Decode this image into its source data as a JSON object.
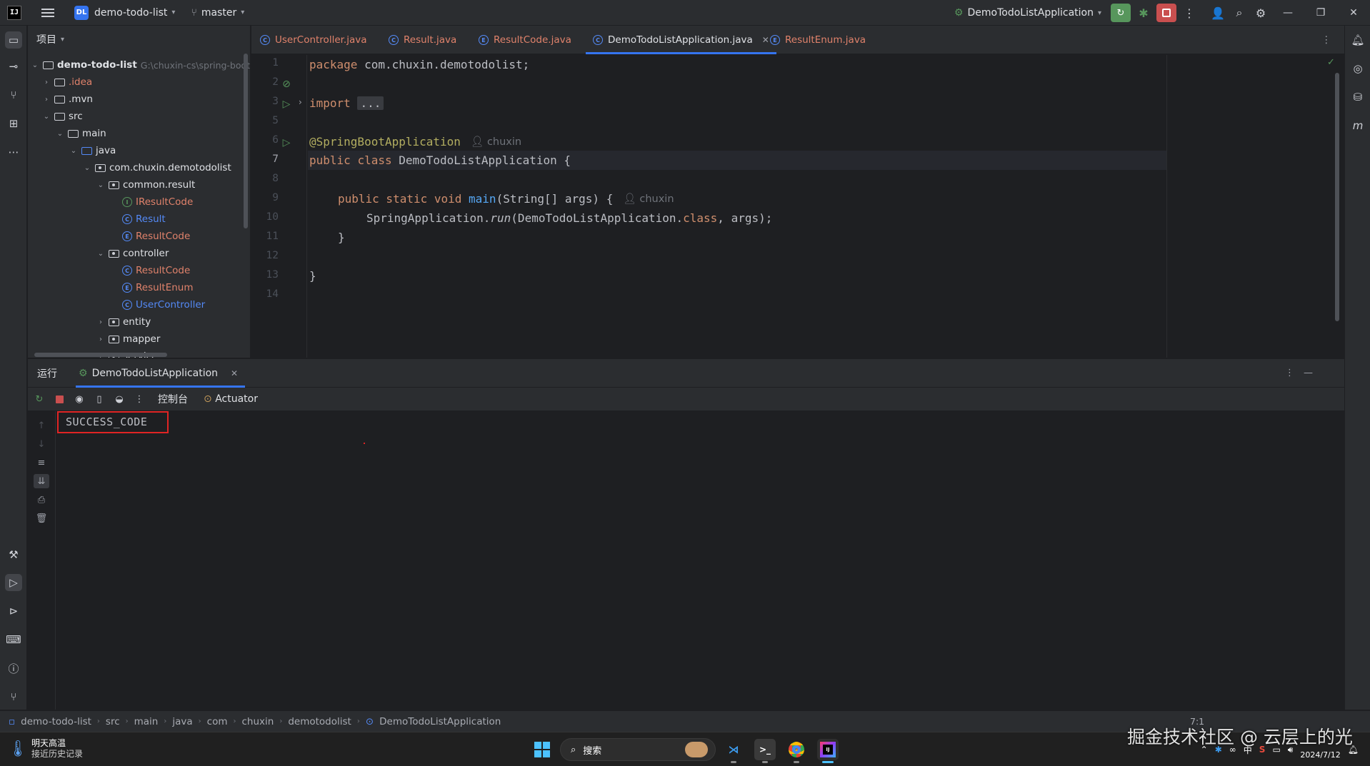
{
  "titlebar": {
    "project_badge": "DL",
    "project_name": "demo-todo-list",
    "branch": "master",
    "run_config": "DemoTodoListApplication"
  },
  "project_panel": {
    "title": "项目",
    "tree": [
      {
        "label": "demo-todo-list",
        "hint": "G:\\chuxin-cs\\spring-boot-",
        "type": "module"
      },
      {
        "label": ".idea",
        "type": "folder"
      },
      {
        "label": ".mvn",
        "type": "folder"
      },
      {
        "label": "src",
        "type": "folder"
      },
      {
        "label": "main",
        "type": "folder"
      },
      {
        "label": "java",
        "type": "folder"
      },
      {
        "label": "com.chuxin.demotodolist",
        "type": "package"
      },
      {
        "label": "common.result",
        "type": "package"
      },
      {
        "label": "IResultCode",
        "type": "interface"
      },
      {
        "label": "Result",
        "type": "class"
      },
      {
        "label": "ResultCode",
        "type": "enum"
      },
      {
        "label": "controller",
        "type": "package"
      },
      {
        "label": "ResultCode",
        "type": "class"
      },
      {
        "label": "ResultEnum",
        "type": "enum"
      },
      {
        "label": "UserController",
        "type": "class"
      },
      {
        "label": "entity",
        "type": "package"
      },
      {
        "label": "mapper",
        "type": "package"
      },
      {
        "label": "service",
        "type": "package"
      }
    ]
  },
  "tabs": [
    {
      "label": "UserController.java"
    },
    {
      "label": "Result.java"
    },
    {
      "label": "ResultCode.java"
    },
    {
      "label": "DemoTodoListApplication.java",
      "active": true
    },
    {
      "label": "ResultEnum.java"
    }
  ],
  "editor": {
    "line_numbers": [
      "1",
      "2",
      "3",
      "5",
      "6",
      "7",
      "8",
      "9",
      "10",
      "11",
      "12",
      "13",
      "14"
    ],
    "current_line": "7",
    "code": {
      "l1_kw": "package",
      "l1_rest": " com.chuxin.demotodolist;",
      "l3_kw": "import",
      "l3_fold": "...",
      "l6_ann": "@SpringBootApplication",
      "l6_author": "chuxin",
      "l7_kw1": "public",
      "l7_kw2": "class",
      "l7_rest": " DemoTodoListApplication {",
      "l9_kw": "public static void",
      "l9_fn": "main",
      "l9_rest": "(String[] args) {",
      "l9_author": "chuxin",
      "l10_a": "SpringApplication.",
      "l10_run": "run",
      "l10_b": "(DemoTodoListApplication.",
      "l10_class": "class",
      "l10_c": ", args);",
      "l11": "}",
      "l13": "}"
    }
  },
  "run_panel": {
    "title": "运行",
    "tab_label": "DemoTodoListApplication",
    "console_tab": "控制台",
    "actuator_tab": "Actuator",
    "output": "SUCCESS_CODE"
  },
  "breadcrumb": [
    "demo-todo-list",
    "src",
    "main",
    "java",
    "com",
    "chuxin",
    "demotodolist",
    "DemoTodoListApplication"
  ],
  "status": {
    "position": "7:1"
  },
  "taskbar": {
    "weather_title": "明天高温",
    "weather_sub": "接近历史记录",
    "search_placeholder": "搜索",
    "date": "2024/7/12",
    "ime": "中"
  },
  "watermark": "掘金技术社区 @ 云层上的光",
  "colors": {
    "accent": "#3574f0",
    "run_green": "#57965c",
    "stop_red": "#c94f4f",
    "highlight": "#e02424"
  }
}
